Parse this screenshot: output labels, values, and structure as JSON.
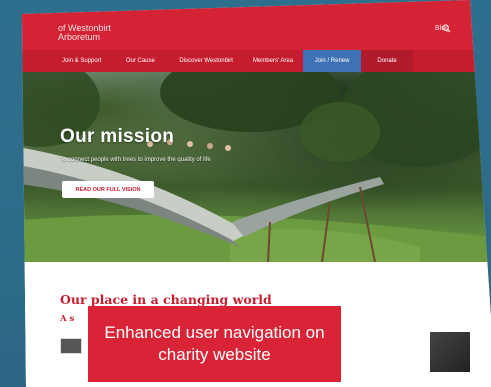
{
  "site": {
    "logo_line1": "of Westonbirt",
    "logo_line2": "Arboretum"
  },
  "utility": {
    "blog": "Blog"
  },
  "nav": {
    "items": [
      "Join & Support",
      "Our Cause",
      "Discover Westonbirt",
      "Members' Area",
      "Join / Renew",
      "Donate"
    ]
  },
  "hero": {
    "title": "Our mission",
    "subtitle": "To connect people with trees to improve the quality of life",
    "button": "READ OUR FULL VISION"
  },
  "section": {
    "title": "Our place in a changing world",
    "sub": "A s"
  },
  "caption": {
    "line1": "Enhanced user navigation on",
    "line2": "charity website"
  },
  "colors": {
    "brand_red": "#d32334",
    "nav_active_blue": "#3f72b5",
    "background_teal": "#2f6f8e"
  }
}
